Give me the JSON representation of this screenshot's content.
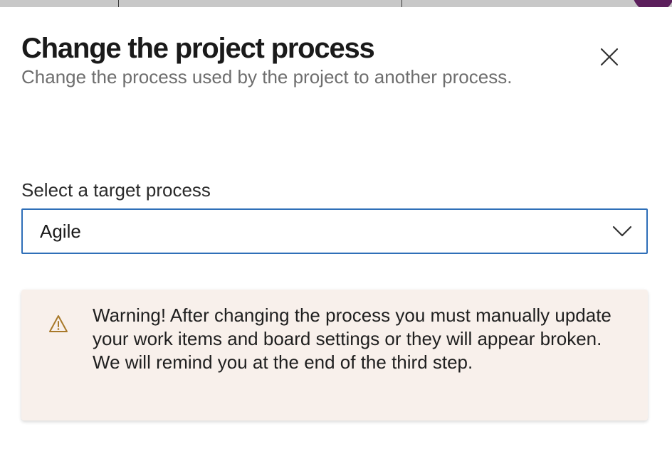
{
  "dialog": {
    "title": "Change the project process",
    "subtitle": "Change the process used by the project to another process.",
    "close_icon": "close-icon"
  },
  "field": {
    "label": "Select a target process",
    "selected_value": "Agile",
    "dropdown_icon": "chevron-down-icon"
  },
  "warning": {
    "icon": "warning-icon",
    "text": "Warning! After changing the process you must manually update your work items and board settings or they will appear broken. We will remind you at the end of the third step."
  },
  "colors": {
    "focus_border": "#2f6fb8",
    "warning_background": "#f8f0eb",
    "warning_icon": "#a8792a",
    "title_text": "#1a1a1a",
    "subtitle_text": "#6e6e6e"
  }
}
